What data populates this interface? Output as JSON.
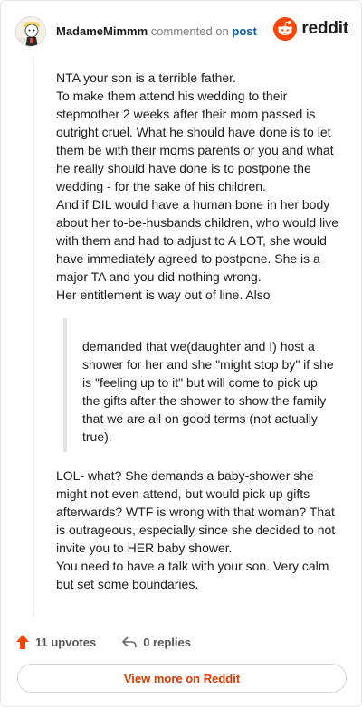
{
  "header": {
    "author": "MadameMimmm",
    "commented_on": "commented on",
    "post_link": "post",
    "brand": "reddit"
  },
  "comment": {
    "paragraphs": [
      "NTA your son is a terrible father.",
      "To make them attend his wedding to their stepmother 2 weeks after their mom passed is outright cruel. What he should have done is to let them be with their moms parents or you and what he really should have done is to postpone the wedding - for the sake of his children.",
      "And if DIL would have a human bone in her body about her to-be-husbands children, who would live with them and had to adjust to A LOT, she would have immediately agreed to postpone. She is a major TA and you did nothing wrong.",
      "Her entitlement is way out of line. Also"
    ],
    "quote": "demanded that we(daughter and I) host a shower for her and she \"might stop by\" if she is \"feeling up to it\" but will come to pick up the gifts after the shower to show the family that we are all on good terms (not actually true).",
    "paragraphs_after": [
      "LOL- what? She demands a baby-shower she might not even attend, but would pick up gifts afterwards? WTF is wrong with that woman? That is outrageous, especially since she decided to not invite you to HER baby shower.",
      "You need to have a talk with your son. Very calm but set some boundaries."
    ]
  },
  "footer": {
    "upvotes": "11 upvotes",
    "replies": "0 replies",
    "view_more": "View more on Reddit"
  },
  "colors": {
    "brand_orange": "#ff4500",
    "link_blue": "#0a5eb3",
    "view_more": "#d93a00"
  },
  "icons": [
    "avatar",
    "reddit-logo-icon",
    "upvote-arrow-icon",
    "reply-arrow-icon"
  ]
}
